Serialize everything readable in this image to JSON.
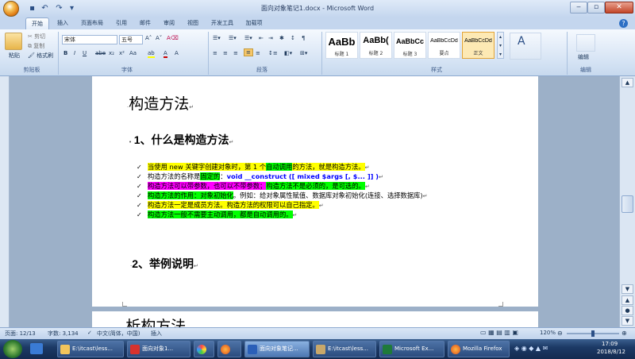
{
  "window": {
    "title": "面向对象笔记1.docx - Microsoft Word"
  },
  "tabs": [
    "开始",
    "插入",
    "页面布局",
    "引用",
    "邮件",
    "审阅",
    "视图",
    "开发工具",
    "加载项"
  ],
  "ribbon": {
    "clipboard": {
      "paste": "粘贴",
      "cut": "剪切",
      "copy": "复制",
      "format_painter": "格式刷",
      "label": "剪贴板"
    },
    "font": {
      "name": "宋体",
      "size": "五号",
      "label": "字体"
    },
    "paragraph": {
      "label": "段落"
    },
    "styles": {
      "label": "样式",
      "items": [
        {
          "sample": "AaBb",
          "name": "标题 1"
        },
        {
          "sample": "AaBb(",
          "name": "标题 2"
        },
        {
          "sample": "AaBbCc",
          "name": "标题 3"
        },
        {
          "sample": "AaBbCcDd",
          "name": "要点"
        },
        {
          "sample": "AaBbCcDd",
          "name": "正文"
        }
      ],
      "change": "更改样式"
    },
    "editing": {
      "label": "编辑",
      "find": "编辑"
    }
  },
  "document": {
    "heading_main": "构造方法",
    "section1": "1、什么是构造方法",
    "bullets": {
      "b1": {
        "a": "当使用 new 关键字创建对象时，第 1 个",
        "b": "自动调用",
        "c": "的方法，就是构造方法。"
      },
      "b2": {
        "a": "构造方法的名称是",
        "b": "固定的",
        "c": "：",
        "d": "void __construct ([ mixed $args [, $... ]] )"
      },
      "b3": {
        "a": "构造方法可以带参数，也可以不带参数；",
        "b": "构造方法不是必须的，是可选的。"
      },
      "b4": {
        "a": "构造方法的作用：对象初始化",
        "b": "。例如：给对象属性赋值、数据库对象初始化(连接、选择数据库)"
      },
      "b5": {
        "a": "构造方法一定是成员方法。构造方法的权限可以自己指定。"
      },
      "b6": {
        "a": "构造方法一般不需要主动调用，都是自动调用的。"
      }
    },
    "section2": "2、举例说明",
    "next_heading": "析构方法"
  },
  "status": {
    "page": "页面: 12/13",
    "words": "字数: 3,134",
    "language": "中文(简体，中国)",
    "insert": "插入",
    "zoom": "120%"
  },
  "taskbar": {
    "items": [
      {
        "label": "E:\\itcast\\less..."
      },
      {
        "label": "面向对象1..."
      },
      {
        "label": ""
      },
      {
        "label": ""
      },
      {
        "label": "面向对象笔记..."
      },
      {
        "label": "E:\\itcast\\less..."
      },
      {
        "label": "Microsoft Ex..."
      },
      {
        "label": "Mozilla Firefox"
      }
    ],
    "time": "17:09",
    "date": "2018/8/12"
  }
}
